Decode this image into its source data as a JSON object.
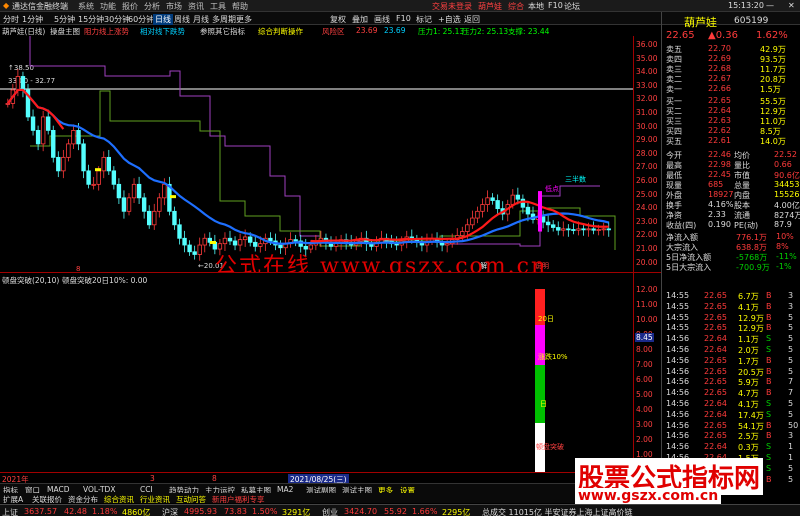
{
  "titlebar": {
    "app_name": "通达信金融终端",
    "menus": [
      "系统",
      "功能",
      "报价",
      "分析",
      "市场",
      "资讯",
      "工具",
      "帮助"
    ],
    "login_label": "交易未登录",
    "stock_name": "葫芦娃",
    "time_label": "15:13:20",
    "buttons": [
      "综合",
      "本地",
      "F10",
      "论坛"
    ]
  },
  "toolbar": {
    "periods": [
      "分时",
      "1分钟",
      "5分钟",
      "15分钟",
      "30分钟",
      "60分钟",
      "日线",
      "周线",
      "月线",
      "多周期",
      "更多"
    ],
    "active": "日线",
    "tools": [
      "复权",
      "叠加",
      "画线",
      "F10",
      "标记",
      "+自选",
      "返回"
    ]
  },
  "info_row": {
    "items": [
      "葫芦娃(日线)",
      "操盘主图",
      "阻力线上涨势",
      "相对线下跌势",
      "参照其它指标",
      "综合判断操作",
      "风险区",
      "23.69",
      "23.69",
      "压力1: 25.13",
      "压力2: 25.13",
      "支撑: 23.44"
    ]
  },
  "main_chart": {
    "price_labels": [
      "36.00",
      "35.00",
      "34.00",
      "33.00",
      "32.00",
      "31.00",
      "30.00",
      "29.00",
      "28.00",
      "27.00",
      "26.00",
      "25.00",
      "24.00",
      "23.00",
      "22.00",
      "21.00",
      "20.00"
    ],
    "hline_label": "33.00 - 32.77",
    "top_label": "38.50",
    "low_label": "20.01",
    "tag_label_left": "8",
    "tag_buy": "解",
    "tag_sell": "说明",
    "tag_low_signal": "三半数",
    "tag_mid_signal": "低点",
    "watermark": "公式在线 www.gszx.com.cn"
  },
  "sub_chart": {
    "title": "顿盘突破(20,10)",
    "subtitle": "顿盘突破20日10%: 0.00",
    "labels": [
      "12.00",
      "11.00",
      "10.00",
      "9.00",
      "8.00",
      "7.00",
      "6.00",
      "5.00",
      "4.00",
      "3.00",
      "2.00",
      "1.00",
      "0.00"
    ],
    "marker_value": "8.45",
    "bar_labels": [
      "20日",
      "涨跌10%",
      "日",
      "顿盘突破"
    ]
  },
  "time_axis": {
    "labels": [
      "2021年",
      "3",
      "8",
      "2021/08/25(三)"
    ]
  },
  "bottom_tabs": {
    "row1": [
      "指标",
      "窗口",
      "MACD",
      "VOL-TDX",
      "CCI",
      "趋势动力",
      "主力运控",
      "私募主图",
      "MA2",
      "测试副图",
      "测试主图",
      "更多",
      "设置"
    ],
    "row2": [
      "扩展A",
      "关联报价",
      "资金分布",
      "综合资讯",
      "行业资讯",
      "互动问答",
      "新用户福利专享"
    ]
  },
  "right_panel": {
    "stock_name": "葫芦娃",
    "stock_code": "605199",
    "price": "22.65",
    "change": "▲0.36",
    "change_pct": "1.62%",
    "asks": [
      {
        "label": "卖五",
        "price": "22.70",
        "vol": "42.9万"
      },
      {
        "label": "卖四",
        "price": "22.69",
        "vol": "93.5万"
      },
      {
        "label": "卖三",
        "price": "22.68",
        "vol": "11.7万"
      },
      {
        "label": "卖二",
        "price": "22.67",
        "vol": "20.8万"
      },
      {
        "label": "卖一",
        "price": "22.66",
        "vol": "1.5万"
      }
    ],
    "bids": [
      {
        "label": "买一",
        "price": "22.65",
        "vol": "55.5万"
      },
      {
        "label": "买二",
        "price": "22.64",
        "vol": "12.9万"
      },
      {
        "label": "买三",
        "price": "22.63",
        "vol": "11.0万"
      },
      {
        "label": "买四",
        "price": "22.62",
        "vol": "8.5万"
      },
      {
        "label": "买五",
        "price": "22.61",
        "vol": "14.0万"
      }
    ],
    "stats": [
      {
        "l1": "今开",
        "v1": "22.46",
        "l2": "均价",
        "v2": "22.52"
      },
      {
        "l1": "最高",
        "v1": "22.98",
        "l2": "量比",
        "v2": "0.66"
      },
      {
        "l1": "最低",
        "v1": "22.45",
        "l2": "市值",
        "v2": "90.6亿"
      },
      {
        "l1": "现量",
        "v1": "685",
        "l2": "总量",
        "v2": "34453"
      },
      {
        "l1": "外盘",
        "v1": "18927",
        "l2": "内盘",
        "v2": "15526"
      },
      {
        "l1": "换手",
        "v1": "4.16%",
        "l2": "股本",
        "v2": "4.00亿"
      },
      {
        "l1": "净资",
        "v1": "2.33",
        "l2": "流通",
        "v2": "8274万"
      },
      {
        "l1": "收益(四)",
        "v1": "0.190",
        "l2": "PE(动)",
        "v2": "87.9"
      }
    ],
    "flows": [
      {
        "label": "净流入额",
        "value": "776.1万",
        "pct": "10%"
      },
      {
        "label": "大宗流入",
        "value": "638.8万",
        "pct": "8%"
      },
      {
        "label": "5日净流入额",
        "value": "-5768万",
        "pct": "-11%"
      },
      {
        "label": "5日大宗流入",
        "value": "-700.9万",
        "pct": "-1%"
      }
    ],
    "ticks": [
      {
        "time": "14:55",
        "price": "22.65",
        "vol": "6.7万",
        "bs": "B",
        "n": "3"
      },
      {
        "time": "14:55",
        "price": "22.65",
        "vol": "4.1万",
        "bs": "B",
        "n": "3"
      },
      {
        "time": "14:55",
        "price": "22.65",
        "vol": "12.9万",
        "bs": "B",
        "n": "5"
      },
      {
        "time": "14:55",
        "price": "22.65",
        "vol": "12.9万",
        "bs": "B",
        "n": "5"
      },
      {
        "time": "14:56",
        "price": "22.64",
        "vol": "1.1万",
        "bs": "S",
        "n": "5"
      },
      {
        "time": "14:56",
        "price": "22.64",
        "vol": "2.0万",
        "bs": "S",
        "n": "5"
      },
      {
        "time": "14:56",
        "price": "22.65",
        "vol": "1.7万",
        "bs": "B",
        "n": "5"
      },
      {
        "time": "14:56",
        "price": "22.65",
        "vol": "20.5万",
        "bs": "B",
        "n": "5"
      },
      {
        "time": "14:56",
        "price": "22.65",
        "vol": "5.9万",
        "bs": "B",
        "n": "7"
      },
      {
        "time": "14:56",
        "price": "22.65",
        "vol": "4.7万",
        "bs": "B",
        "n": "7"
      },
      {
        "time": "14:56",
        "price": "22.64",
        "vol": "4.1万",
        "bs": "S",
        "n": "5"
      },
      {
        "time": "14:56",
        "price": "22.64",
        "vol": "17.4万",
        "bs": "S",
        "n": "5"
      },
      {
        "time": "14:56",
        "price": "22.65",
        "vol": "54.1万",
        "bs": "B",
        "n": "50"
      },
      {
        "time": "14:56",
        "price": "22.65",
        "vol": "2.5万",
        "bs": "B",
        "n": "3"
      },
      {
        "time": "14:56",
        "price": "22.64",
        "vol": "0.3万",
        "bs": "S",
        "n": "1"
      },
      {
        "time": "14:56",
        "price": "22.64",
        "vol": "1.5万",
        "bs": "S",
        "n": "1"
      },
      {
        "time": "14:56",
        "price": "22.64",
        "vol": "1.0万",
        "bs": "S",
        "n": "5"
      },
      {
        "time": "14:56",
        "price": "22.65",
        "vol": "1.8万",
        "bs": "B",
        "n": "5"
      }
    ]
  },
  "status": {
    "items": [
      {
        "label": "上证",
        "v1": "3637.57",
        "v2": "42.48",
        "v3": "1.18%",
        "v4": "4860亿"
      },
      {
        "label": "沪深",
        "v1": "4995.93",
        "v2": "73.83",
        "v3": "1.50%",
        "v4": "3291亿"
      },
      {
        "label": "创业",
        "v1": "3424.70",
        "v2": "55.92",
        "v3": "1.66%",
        "v4": "2295亿"
      }
    ],
    "news": "总成交 11015亿 半安证券上海上证高价链"
  },
  "brand_watermark": {
    "line1": "股票公式指标网",
    "line2": "www.gszx.com.cn"
  },
  "colors": {
    "up": "#ff3b3b",
    "down": "#00ffff",
    "ma_blue": "#1e6fff",
    "ma_red": "#ff1a1a",
    "resistance": "#a040c0",
    "support": "#60a020"
  }
}
